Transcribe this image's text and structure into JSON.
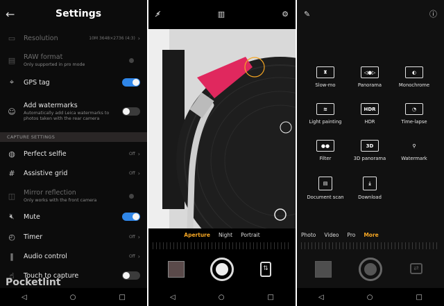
{
  "settings": {
    "title": "Settings",
    "back_icon": "arrow-left-icon",
    "rows": [
      {
        "label": "Resolution",
        "value": "10M 3648×2736 (4:3)",
        "sub": "",
        "enabled": false
      },
      {
        "label": "RAW format",
        "sub": "Only supported in pro mode",
        "enabled": false
      },
      {
        "label": "GPS tag",
        "sub": "",
        "enabled": true,
        "on": true
      },
      {
        "label": "Add watermarks",
        "sub": "Automatically add Leica watermarks to photos taken with the rear camera",
        "enabled": true,
        "on": false
      },
      {
        "label": "Perfect selfie",
        "value": "Off",
        "sub": "",
        "enabled": true
      },
      {
        "label": "Assistive grid",
        "value": "Off",
        "sub": "",
        "enabled": true
      },
      {
        "label": "Mirror reflection",
        "sub": "Only works with the front camera",
        "enabled": false
      },
      {
        "label": "Mute",
        "sub": "",
        "enabled": true,
        "on": true
      },
      {
        "label": "Timer",
        "value": "Off",
        "sub": "",
        "enabled": true
      },
      {
        "label": "Audio control",
        "value": "Off",
        "sub": "",
        "enabled": true
      },
      {
        "label": "Touch to capture",
        "sub": "",
        "enabled": true,
        "on": false
      }
    ],
    "section_label": "CAPTURE SETTINGS",
    "watermark": "Pocketlint"
  },
  "camera": {
    "modes": [
      "Aperture",
      "Night",
      "Portrait"
    ],
    "active_mode": "Aperture"
  },
  "more": {
    "tiles": [
      {
        "label": "Slow-mo",
        "icon": "hourglass-icon"
      },
      {
        "label": "Panorama",
        "icon": "panorama-icon"
      },
      {
        "label": "Monochrome",
        "icon": "monochrome-icon"
      },
      {
        "label": "Light painting",
        "icon": "light-painting-icon"
      },
      {
        "label": "HDR",
        "icon": "hdr-icon",
        "text": "HDR"
      },
      {
        "label": "Time-lapse",
        "icon": "time-lapse-icon"
      },
      {
        "label": "Filter",
        "icon": "filter-icon"
      },
      {
        "label": "3D panorama",
        "icon": "3d-icon",
        "text": "3D"
      },
      {
        "label": "Watermark",
        "icon": "watermark-icon"
      },
      {
        "label": "Document scan",
        "icon": "document-icon"
      },
      {
        "label": "Download",
        "icon": "download-icon"
      }
    ],
    "modes": [
      "Photo",
      "Video",
      "Pro",
      "More"
    ],
    "active_mode": "More"
  },
  "nav": {
    "back": "◁",
    "home": "○",
    "recent": "□"
  }
}
